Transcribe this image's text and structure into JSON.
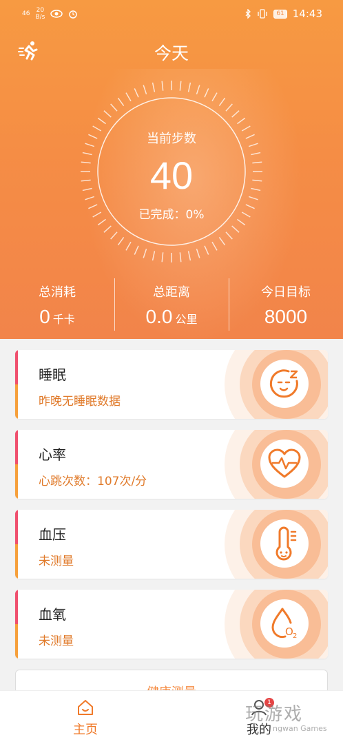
{
  "status_bar": {
    "signal": "46",
    "speed_value": "20",
    "speed_unit": "B/s",
    "battery": "61",
    "time": "14:43"
  },
  "header": {
    "title": "今天"
  },
  "steps": {
    "label": "当前步数",
    "value": "40",
    "progress": "已完成：0%"
  },
  "stats": [
    {
      "label": "总消耗",
      "value": "0",
      "unit": "千卡"
    },
    {
      "label": "总距离",
      "value": "0.0",
      "unit": "公里"
    },
    {
      "label": "今日目标",
      "value": "8000",
      "unit": ""
    }
  ],
  "cards": [
    {
      "title": "睡眠",
      "subtitle": "昨晚无睡眠数据",
      "icon": "sleep-face-icon"
    },
    {
      "title": "心率",
      "subtitle": "心跳次数：107次/分",
      "icon": "heart-rate-icon"
    },
    {
      "title": "血压",
      "subtitle": "未测量",
      "icon": "thermometer-icon"
    },
    {
      "title": "血氧",
      "subtitle": "未测量",
      "icon": "oxygen-drop-icon"
    }
  ],
  "measure_button": "健康测量",
  "tabs": {
    "home": "主页",
    "me": "我的",
    "badge": "1"
  },
  "watermark": {
    "text": "玩游戏",
    "sub": "ngwan Games"
  },
  "colors": {
    "accent": "#f58d45",
    "card_text": "#e07a2a",
    "bar_top": "#f0506e",
    "bar_bottom": "#f6a03b"
  }
}
